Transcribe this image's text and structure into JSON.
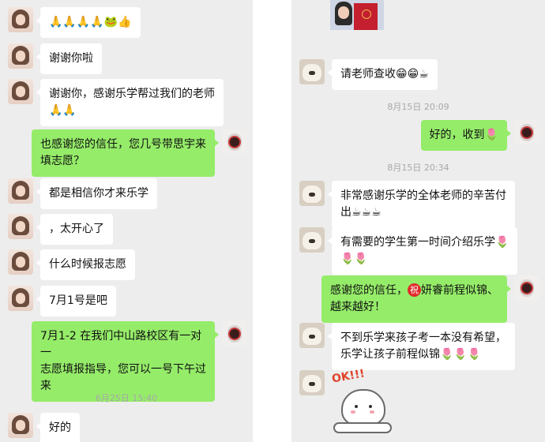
{
  "left": {
    "messages": [
      {
        "dir": "in",
        "text": "🙏🙏🙏🙏🐸👍"
      },
      {
        "dir": "in",
        "text": "谢谢你啦"
      },
      {
        "dir": "in",
        "text": "谢谢你，感谢乐学帮过我们的老师\n🙏🙏"
      },
      {
        "dir": "out",
        "text": "也感谢您的信任，您几号带思宇来\n填志愿？"
      },
      {
        "dir": "in",
        "text": "都是相信你才来乐学"
      },
      {
        "dir": "in",
        "text": "，太开心了"
      },
      {
        "dir": "in",
        "text": "什么时候报志愿"
      },
      {
        "dir": "in",
        "text": "7月1号是吧"
      },
      {
        "dir": "out",
        "text": "7月1-2 在我们中山路校区有一对一\n志愿填报指导，您可以一号下午过\n来"
      },
      {
        "dir": "in",
        "text": "好的"
      }
    ],
    "timestamp": "6月25日 15:40"
  },
  "right": {
    "messages": [
      {
        "dir": "in",
        "text": "请老师查收😁😁☕"
      },
      {
        "dir": "out",
        "text": "好的，收到🌷"
      },
      {
        "dir": "in",
        "text": "非常感谢乐学的全体老师的辛苦付\n出☕☕☕"
      },
      {
        "dir": "in",
        "text": "有需要的学生第一时间介绍乐学🌷\n🌷🌷"
      },
      {
        "dir": "out",
        "text_a": "感谢您的信任，",
        "badge": "祝",
        "text_b": "妍睿前程似锦、\n越来越好！"
      },
      {
        "dir": "in",
        "text": "不到乐学来孩子考一本没有希望，\n乐学让孩子前程似锦🌷🌷🌷"
      }
    ],
    "timestamps": [
      "8月15日 20:09",
      "8月15日 20:34"
    ],
    "sticker_text": "OK!!!"
  },
  "colors": {
    "chat_bg": "#ededed",
    "outgoing_bubble": "#95ec69",
    "incoming_bubble": "#ffffff",
    "timestamp": "#a8a8a8"
  }
}
